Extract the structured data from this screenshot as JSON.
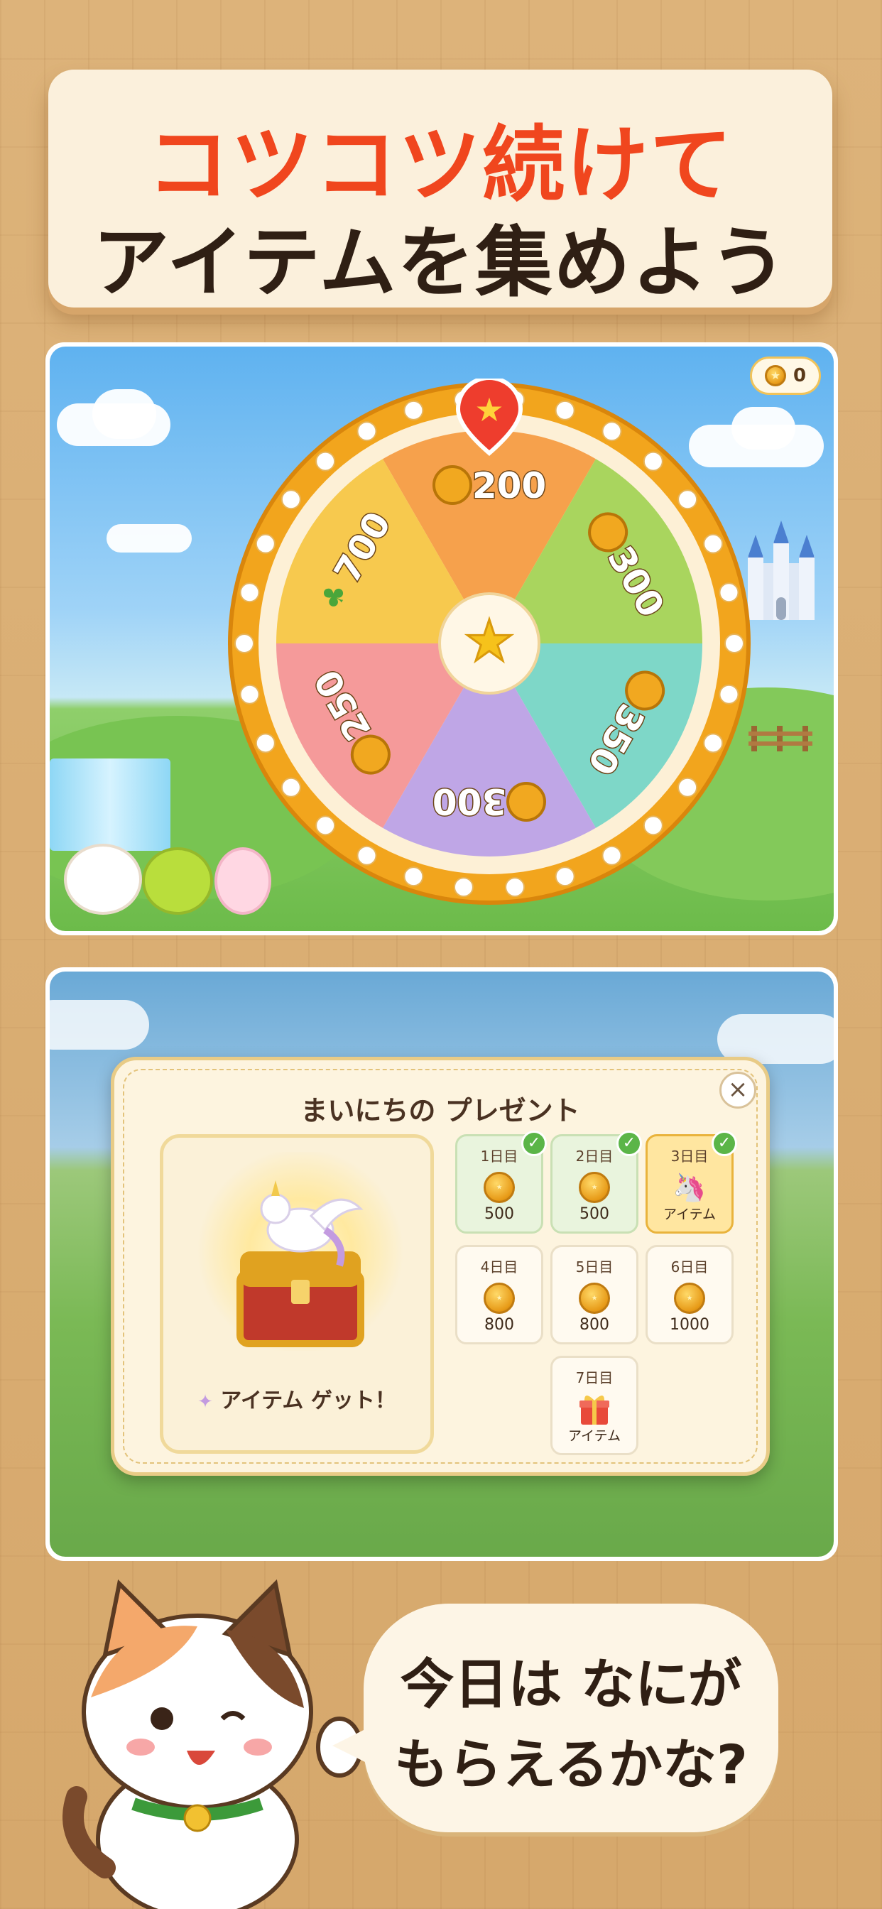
{
  "hero": {
    "line1": "コツコツ続けて",
    "line2": "アイテムを集めよう"
  },
  "roulette": {
    "coin_balance": "0",
    "segments": [
      {
        "value": "200",
        "color": "#f6a14c",
        "icon": "coin-icon"
      },
      {
        "value": "300",
        "color": "#a9d55e",
        "icon": "coin-icon"
      },
      {
        "value": "350",
        "color": "#7ed7c8",
        "icon": "coin-icon"
      },
      {
        "value": "300",
        "color": "#bfa6e6",
        "icon": "coin-icon"
      },
      {
        "value": "250",
        "color": "#f59a9a",
        "icon": "coin-icon"
      },
      {
        "value": "700",
        "color": "#f7c94e",
        "icon": "sprout-icon"
      }
    ]
  },
  "daily_present": {
    "title": "まいにちの プレゼント",
    "reward_label": "アイテム ゲット！",
    "days": [
      {
        "day": "1日目",
        "reward": "500",
        "claimed": true,
        "icon": "coin-icon"
      },
      {
        "day": "2日目",
        "reward": "500",
        "claimed": true,
        "icon": "coin-icon"
      },
      {
        "day": "3日目",
        "reward": "アイテム",
        "claimed": true,
        "icon": "unicorn-icon"
      },
      {
        "day": "4日目",
        "reward": "800",
        "claimed": false,
        "icon": "coin-icon"
      },
      {
        "day": "5日目",
        "reward": "800",
        "claimed": false,
        "icon": "coin-icon"
      },
      {
        "day": "6日目",
        "reward": "1000",
        "claimed": false,
        "icon": "coin-icon"
      },
      {
        "day": "7日目",
        "reward": "アイテム",
        "claimed": false,
        "icon": "gift-icon"
      }
    ]
  },
  "speech": {
    "line1": "今日は なにが",
    "line2": "もらえるかな?"
  }
}
